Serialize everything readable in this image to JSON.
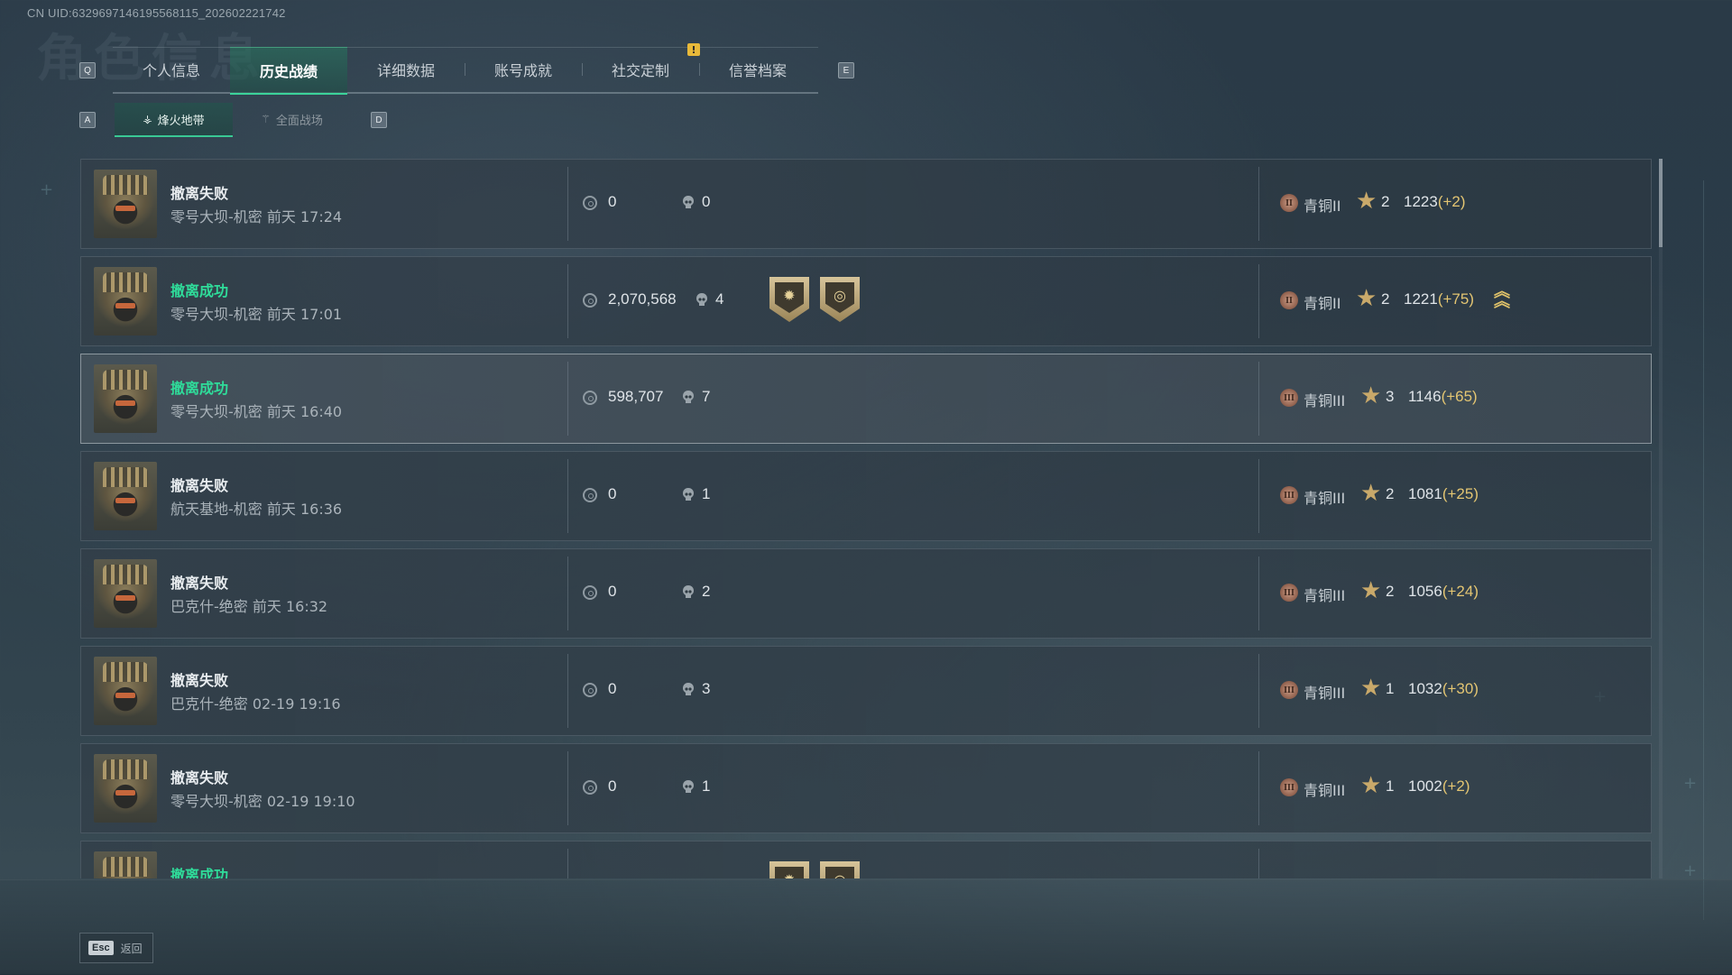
{
  "uid": "CN UID:6329697146195568115_202602221742",
  "ghost_title": "角色信息",
  "key_hints": {
    "left_tab": "Q",
    "right_tab": "E",
    "left_sub": "A",
    "right_sub": "D"
  },
  "tabs": [
    {
      "label": "个人信息"
    },
    {
      "label": "历史战绩"
    },
    {
      "label": "详细数据"
    },
    {
      "label": "账号成就"
    },
    {
      "label": "社交定制"
    },
    {
      "label": "信誉档案"
    }
  ],
  "tab_alert": "!",
  "subtabs": [
    {
      "label": "烽火地带",
      "icon": "⚶"
    },
    {
      "label": "全面战场",
      "icon": "⚚"
    }
  ],
  "rows": [
    {
      "status": "撤离失败",
      "success": false,
      "map": "零号大坝-机密",
      "time": "前天 17:24",
      "money": "0",
      "kills": "0",
      "badges": [],
      "rank_tier": "II",
      "rank": "青铜II",
      "stars": "2",
      "score": "1223",
      "delta": "(+2)",
      "promo": false
    },
    {
      "status": "撤离成功",
      "success": true,
      "map": "零号大坝-机密",
      "time": "前天 17:01",
      "money": "2,070,568",
      "kills": "4",
      "badges": [
        "sun-badge-icon",
        "target-badge-icon"
      ],
      "rank_tier": "II",
      "rank": "青铜II",
      "stars": "2",
      "score": "1221",
      "delta": "(+75)",
      "promo": true
    },
    {
      "status": "撤离成功",
      "success": true,
      "map": "零号大坝-机密",
      "time": "前天 16:40",
      "money": "598,707",
      "kills": "7",
      "badges": [],
      "rank_tier": "III",
      "rank": "青铜III",
      "stars": "3",
      "score": "1146",
      "delta": "(+65)",
      "promo": false
    },
    {
      "status": "撤离失败",
      "success": false,
      "map": "航天基地-机密",
      "time": "前天 16:36",
      "money": "0",
      "kills": "1",
      "badges": [],
      "rank_tier": "III",
      "rank": "青铜III",
      "stars": "2",
      "score": "1081",
      "delta": "(+25)",
      "promo": false
    },
    {
      "status": "撤离失败",
      "success": false,
      "map": "巴克什-绝密",
      "time": "前天 16:32",
      "money": "0",
      "kills": "2",
      "badges": [],
      "rank_tier": "III",
      "rank": "青铜III",
      "stars": "2",
      "score": "1056",
      "delta": "(+24)",
      "promo": false
    },
    {
      "status": "撤离失败",
      "success": false,
      "map": "巴克什-绝密",
      "time": "02-19 19:16",
      "money": "0",
      "kills": "3",
      "badges": [],
      "rank_tier": "III",
      "rank": "青铜III",
      "stars": "1",
      "score": "1032",
      "delta": "(+30)",
      "promo": false
    },
    {
      "status": "撤离失败",
      "success": false,
      "map": "零号大坝-机密",
      "time": "02-19 19:10",
      "money": "0",
      "kills": "1",
      "badges": [],
      "rank_tier": "III",
      "rank": "青铜III",
      "stars": "1",
      "score": "1002",
      "delta": "(+2)",
      "promo": false
    },
    {
      "status": "撤离成功",
      "success": true,
      "map": "",
      "time": "",
      "money": "",
      "kills": "",
      "badges": [
        "sun-badge-icon",
        "target-badge-icon"
      ],
      "rank_tier": "",
      "rank": "",
      "stars": "",
      "score": "",
      "delta": "",
      "promo": false
    }
  ],
  "footer": {
    "esc_key": "Esc",
    "esc_label": "返回"
  },
  "colors": {
    "accent": "#3bd39a",
    "success": "#2fdc9a",
    "delta": "#e3c572",
    "star": "#c9a96a"
  }
}
